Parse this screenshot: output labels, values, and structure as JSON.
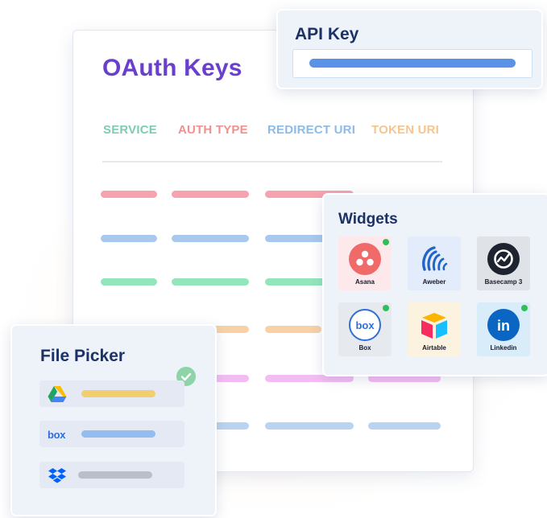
{
  "oauth": {
    "title": "OAuth Keys",
    "columns": [
      {
        "label": "SERVICE",
        "color": "#7ecbb6"
      },
      {
        "label": "AUTH TYPE",
        "color": "#f3908f"
      },
      {
        "label": "REDIRECT URI",
        "color": "#8dbbe8"
      },
      {
        "label": "TOKEN URI",
        "color": "#f5c48f"
      }
    ],
    "row_colors": [
      "#f6a3ae",
      "#a9c8ee",
      "#93e5bc",
      "#f9d1a6",
      "#f3bdf2",
      "#b9d3f3"
    ]
  },
  "api_key": {
    "title": "API Key",
    "bar_color": "#5a92e8"
  },
  "widgets": {
    "title": "Widgets",
    "items": [
      {
        "label": "Asana",
        "icon": "asana-icon",
        "connected": true
      },
      {
        "label": "Aweber",
        "icon": "aweber-icon",
        "connected": false
      },
      {
        "label": "Basecamp 3",
        "icon": "basecamp-icon",
        "connected": false
      },
      {
        "label": "Box",
        "icon": "box-icon",
        "connected": true
      },
      {
        "label": "Airtable",
        "icon": "airtable-icon",
        "connected": false
      },
      {
        "label": "Linkedin",
        "icon": "linkedin-icon",
        "connected": true
      }
    ]
  },
  "file_picker": {
    "title": "File Picker",
    "items": [
      {
        "icon": "google-drive-icon",
        "bar_color": "#f2cf6e"
      },
      {
        "icon": "box-icon",
        "logo_text": "box",
        "bar_color": "#93bdee"
      },
      {
        "icon": "dropbox-icon",
        "bar_color": "#b9bec8"
      }
    ]
  },
  "colors": {
    "title_purple": "#6a3fce",
    "heading_navy": "#1c3266",
    "check_green": "#2fbf59"
  }
}
